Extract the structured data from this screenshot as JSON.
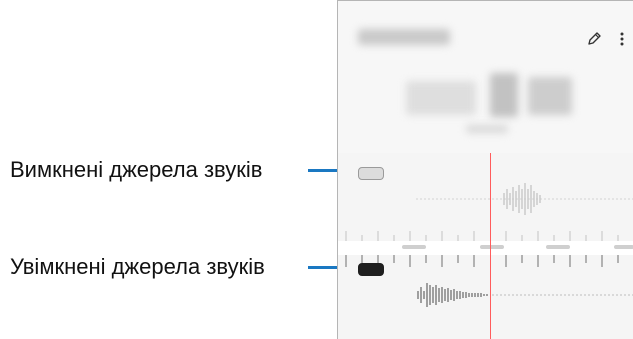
{
  "callouts": {
    "muted_label": "Вимкнені джерела звуків",
    "unmuted_label": "Увімкнені джерела звуків"
  },
  "colors": {
    "callout_line": "#1a78c2",
    "playhead": "#ff5c5c",
    "track_on": "#1f1f1f",
    "track_off": "#dcdcdc"
  },
  "icons": {
    "edit": "pencil-icon",
    "more": "more-vertical-icon"
  }
}
